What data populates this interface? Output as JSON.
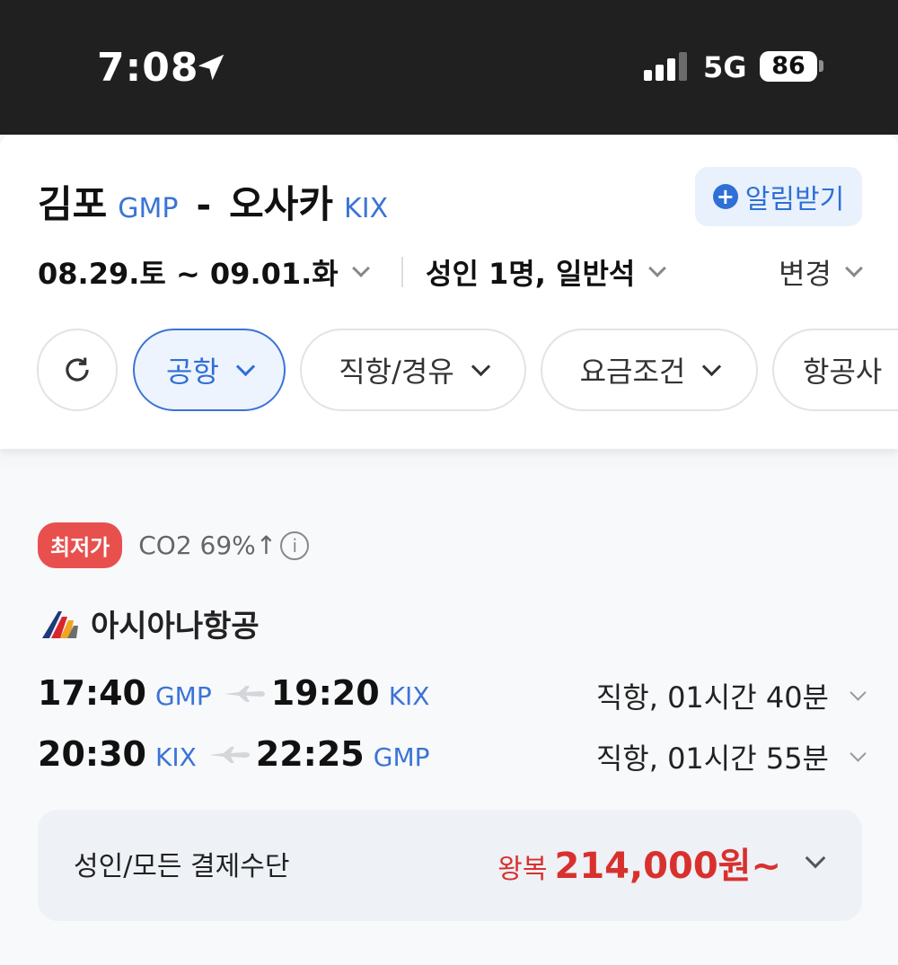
{
  "status_bar": {
    "time": "7:08",
    "network": "5G",
    "battery": "86",
    "icons": [
      "location-arrow-icon",
      "signal-icon",
      "battery-icon"
    ]
  },
  "route": {
    "origin_city": "김포",
    "origin_code": "GMP",
    "separator": "-",
    "dest_city": "오사카",
    "dest_code": "KIX",
    "alert_label": "알림받기"
  },
  "search": {
    "dates": "08.29.토 ~ 09.01.화",
    "passengers": "성인 1명, 일반석",
    "change_label": "변경"
  },
  "filters": [
    {
      "label": "공항",
      "active": true
    },
    {
      "label": "직항/경유",
      "active": false
    },
    {
      "label": "요금조건",
      "active": false
    },
    {
      "label": "항공사",
      "active": false
    }
  ],
  "result": {
    "badge": "최저가",
    "co2": "CO2 69%↑",
    "airline": "아시아나항공",
    "legs": [
      {
        "dep_time": "17:40",
        "dep_code": "GMP",
        "arr_time": "19:20",
        "arr_code": "KIX",
        "info": "직항, 01시간 40분"
      },
      {
        "dep_time": "20:30",
        "dep_code": "KIX",
        "arr_time": "22:25",
        "arr_code": "GMP",
        "info": "직항, 01시간 55분"
      }
    ],
    "price_label": "성인/모든 결제수단",
    "trip_type": "왕복",
    "price": "214,000원~"
  },
  "colors": {
    "accent": "#3b74d6",
    "price_red": "#d8312d",
    "badge_red": "#e8504e",
    "status_bar": "#202020"
  }
}
